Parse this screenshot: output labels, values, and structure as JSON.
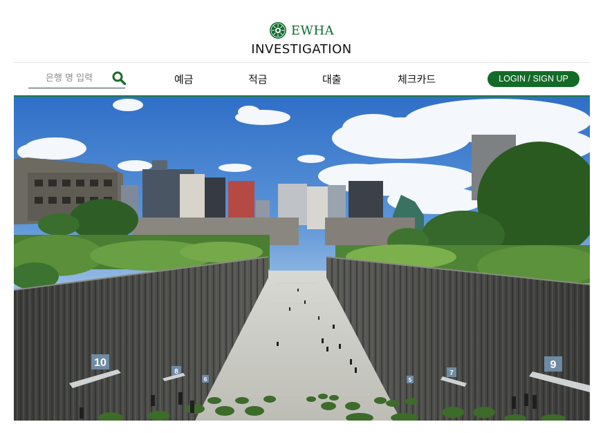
{
  "logo": {
    "brand": "EWHA",
    "subtitle": "INVESTIGATION",
    "icon": "ewha-emblem-icon"
  },
  "nav": {
    "search": {
      "placeholder": "은행 명 입력",
      "value": "",
      "icon": "search-icon"
    },
    "menu": [
      "예금",
      "적금",
      "대출",
      "체크카드"
    ],
    "login_label": "LOGIN / SIGN UP"
  },
  "hero": {
    "subject": "campus-photo",
    "gate_numbers": [
      "10",
      "8",
      "6",
      "5",
      "7",
      "9"
    ]
  },
  "colors": {
    "brand_green": "#146b28",
    "divider_green": "#1e7a34",
    "search_icon": "#1a6b2a"
  }
}
